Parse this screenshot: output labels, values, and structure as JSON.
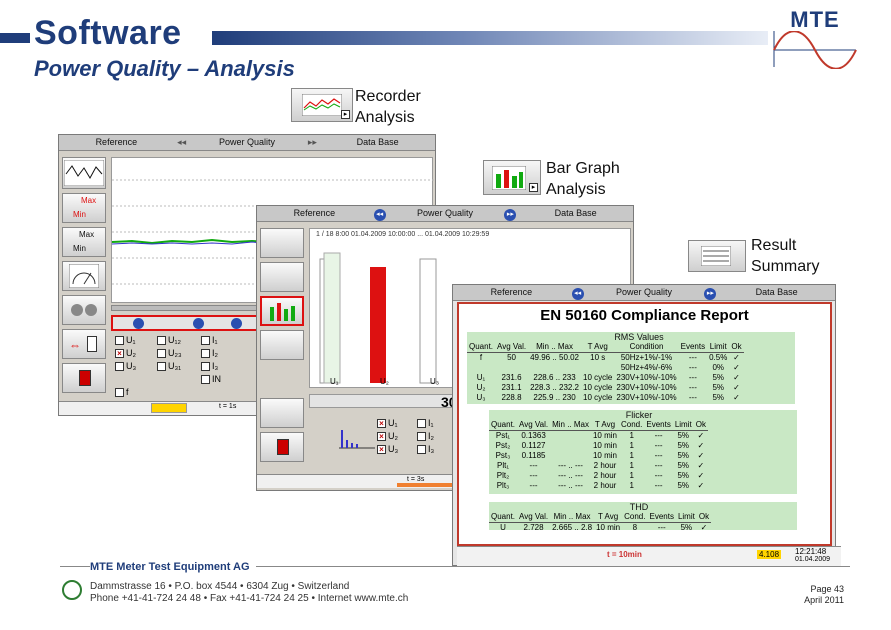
{
  "slide": {
    "title": "Software",
    "subtitle": "Power Quality – Analysis",
    "logo_text": "MTE",
    "brand_color": "#1f3d7a"
  },
  "callouts": {
    "recorder": "Recorder\nAnalysis",
    "bar_graph": "Bar Graph\nAnalysis",
    "result_summary": "Result\nSummary"
  },
  "tabs": {
    "reference": "Reference",
    "power_quality": "Power Quality",
    "data_base": "Data Base"
  },
  "recorder_window": {
    "side_labels": {
      "max": "Max",
      "min": "Min"
    },
    "signals": [
      "U₁",
      "U₂",
      "U₃",
      "U₁₂",
      "U₂₃",
      "U₃₁",
      "I₁",
      "I₂",
      "I₃",
      "IN",
      "f"
    ],
    "timebase": "t = 1s"
  },
  "bar_window": {
    "header": "1 / 18  8:00  01.04.2009 10:00:00  ...  01.04.2009 10:29:59",
    "phase_labels": [
      "U₁",
      "U₂",
      "U₃"
    ],
    "signals": [
      "U₁",
      "U₂",
      "U₃",
      "I₁",
      "I₂",
      "I₃",
      "IN"
    ],
    "timebase": "t = 3s",
    "side_number": "30"
  },
  "report": {
    "title": "EN 50160 Compliance Report",
    "rms": {
      "title": "RMS Values",
      "columns": [
        "Quant.",
        "Avg Val.",
        "Min .. Max",
        "T Avg",
        "Condition",
        "Events",
        "Limit",
        "Ok"
      ],
      "rows": [
        [
          "f",
          "50",
          "49.96 .. 50.02",
          "10 s",
          "50Hz+1%/-1%",
          "---",
          "0.5%",
          "✓"
        ],
        [
          "",
          "",
          "",
          "",
          "50Hz+4%/-6%",
          "---",
          "0%",
          "✓"
        ],
        [
          "U₁",
          "231.6",
          "228.6 .. 233",
          "10 cycle",
          "230V+10%/-10%",
          "---",
          "5%",
          "✓"
        ],
        [
          "U₂",
          "231.1",
          "228.3 .. 232.2",
          "10 cycle",
          "230V+10%/-10%",
          "---",
          "5%",
          "✓"
        ],
        [
          "U₃",
          "228.8",
          "225.9 .. 230",
          "10 cycle",
          "230V+10%/-10%",
          "---",
          "5%",
          "✓"
        ]
      ]
    },
    "flicker": {
      "title": "Flicker",
      "columns": [
        "Quant.",
        "Avg Val.",
        "Min .. Max",
        "T Avg",
        "Cond.",
        "Events",
        "Limit",
        "Ok"
      ],
      "rows": [
        [
          "Pst₁",
          "0.1363",
          "",
          "10 min",
          "1",
          "---",
          "5%",
          "✓"
        ],
        [
          "Pst₂",
          "0.1127",
          "",
          "10 min",
          "1",
          "---",
          "5%",
          "✓"
        ],
        [
          "Pst₃",
          "0.1185",
          "",
          "10 min",
          "1",
          "---",
          "5%",
          "✓"
        ],
        [
          "Plt₁",
          "---",
          "--- .. ---",
          "2 hour",
          "1",
          "---",
          "5%",
          "✓"
        ],
        [
          "Plt₂",
          "---",
          "--- .. ---",
          "2 hour",
          "1",
          "---",
          "5%",
          "✓"
        ],
        [
          "Plt₃",
          "---",
          "--- .. ---",
          "2 hour",
          "1",
          "---",
          "5%",
          "✓"
        ]
      ]
    },
    "thd": {
      "title": "THD",
      "columns": [
        "Quant.",
        "Avg Val.",
        "Min .. Max",
        "T Avg",
        "Cond.",
        "Events",
        "Limit",
        "Ok"
      ],
      "rows": [
        [
          "U",
          "2.728",
          "2.665 .. 2.8",
          "10 min",
          "8",
          "---",
          "5%",
          "✓"
        ]
      ]
    },
    "status": {
      "timebase": "t = 10min",
      "value": "4.108",
      "date": "12:21:48",
      "date2": "01.04.2009"
    }
  },
  "footer": {
    "company": "MTE Meter Test Equipment AG",
    "address": "Dammstrasse 16 • P.O. box 4544 • 6304 Zug • Switzerland",
    "contact": "Phone +41-41-724 24 48 • Fax +41-41-724 24 25 • Internet www.mte.ch",
    "page": "Page 43",
    "date": "April 2011"
  }
}
